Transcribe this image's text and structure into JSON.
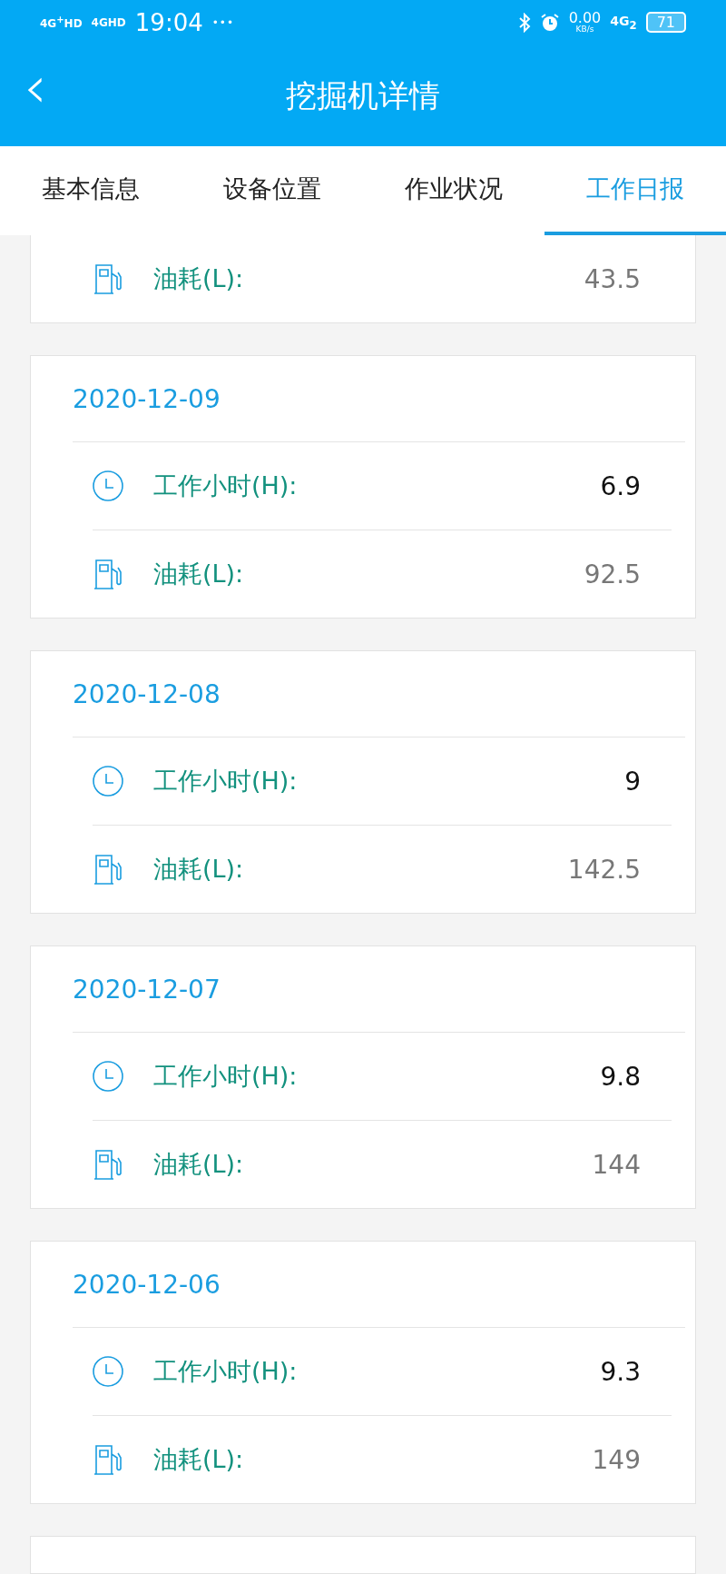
{
  "status_bar": {
    "network_1": "4G$^{+}$HD",
    "network_2": "4GHD",
    "time": "19:04",
    "more": "•••",
    "speed": "0.00",
    "speed_unit": "KB/s",
    "network_3": "4G$_{2}$",
    "battery": "71"
  },
  "header": {
    "back": "‹",
    "title": "挖掘机详情"
  },
  "tabs": [
    {
      "label": "基本信息",
      "selected": false
    },
    {
      "label": "设备位置",
      "selected": false
    },
    {
      "label": "作业状况",
      "selected": false
    },
    {
      "label": "工作日报",
      "selected": true
    }
  ],
  "partial_top_card": {
    "rows": [
      {
        "kind": "fuel",
        "label": "油耗(L):",
        "value": "43.5"
      }
    ]
  },
  "reports": [
    {
      "date": "2020-12-09",
      "rows": [
        {
          "kind": "hours",
          "label": "工作小时(H):",
          "value": "6.9"
        },
        {
          "kind": "fuel",
          "label": "油耗(L):",
          "value": "92.5"
        }
      ]
    },
    {
      "date": "2020-12-08",
      "rows": [
        {
          "kind": "hours",
          "label": "工作小时(H):",
          "value": "9"
        },
        {
          "kind": "fuel",
          "label": "油耗(L):",
          "value": "142.5"
        }
      ]
    },
    {
      "date": "2020-12-07",
      "rows": [
        {
          "kind": "hours",
          "label": "工作小时(H):",
          "value": "9.8"
        },
        {
          "kind": "fuel",
          "label": "油耗(L):",
          "value": "144"
        }
      ]
    },
    {
      "date": "2020-12-06",
      "rows": [
        {
          "kind": "hours",
          "label": "工作小时(H):",
          "value": "9.3"
        },
        {
          "kind": "fuel",
          "label": "油耗(L):",
          "value": "149"
        }
      ]
    }
  ]
}
